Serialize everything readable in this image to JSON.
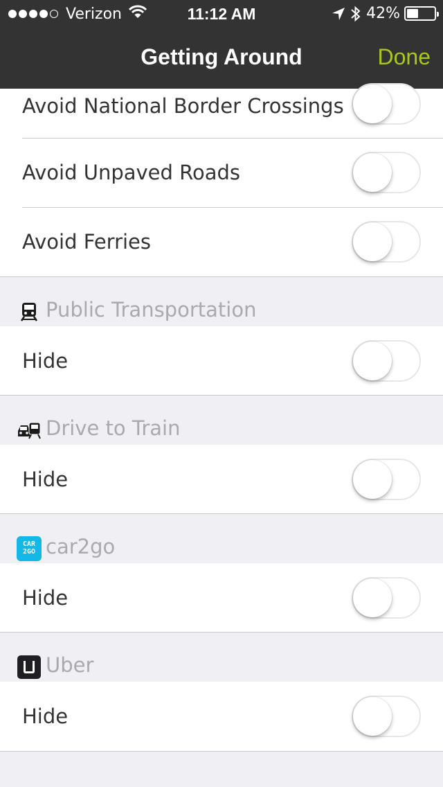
{
  "status_bar": {
    "carrier": "Verizon",
    "time": "11:12 AM",
    "battery_percent": "42%",
    "battery_level": 0.42,
    "signal_bars": 4,
    "signal_max": 5,
    "icons": [
      "wifi-icon",
      "location-arrow-icon",
      "bluetooth-icon",
      "battery-icon"
    ]
  },
  "nav": {
    "title": "Getting Around",
    "done_label": "Done",
    "accent_color": "#a8c81e"
  },
  "avoid_group": {
    "rows": [
      {
        "label": "Avoid National Border Crossings",
        "toggle_on": false
      },
      {
        "label": "Avoid Unpaved Roads",
        "toggle_on": false
      },
      {
        "label": "Avoid Ferries",
        "toggle_on": false
      }
    ]
  },
  "sections": [
    {
      "title": "Public Transportation",
      "icon": "train-icon",
      "row_label": "Hide",
      "toggle_on": false
    },
    {
      "title": "Drive to Train",
      "icon": "car-train-icon",
      "row_label": "Hide",
      "toggle_on": false
    },
    {
      "title": "car2go",
      "icon": "car2go-logo-icon",
      "icon_text": "CAR 2GO",
      "icon_color": "#14b8e6",
      "row_label": "Hide",
      "toggle_on": false
    },
    {
      "title": "Uber",
      "icon": "uber-logo-icon",
      "icon_color": "#1e1e23",
      "row_label": "Hide",
      "toggle_on": false
    }
  ]
}
